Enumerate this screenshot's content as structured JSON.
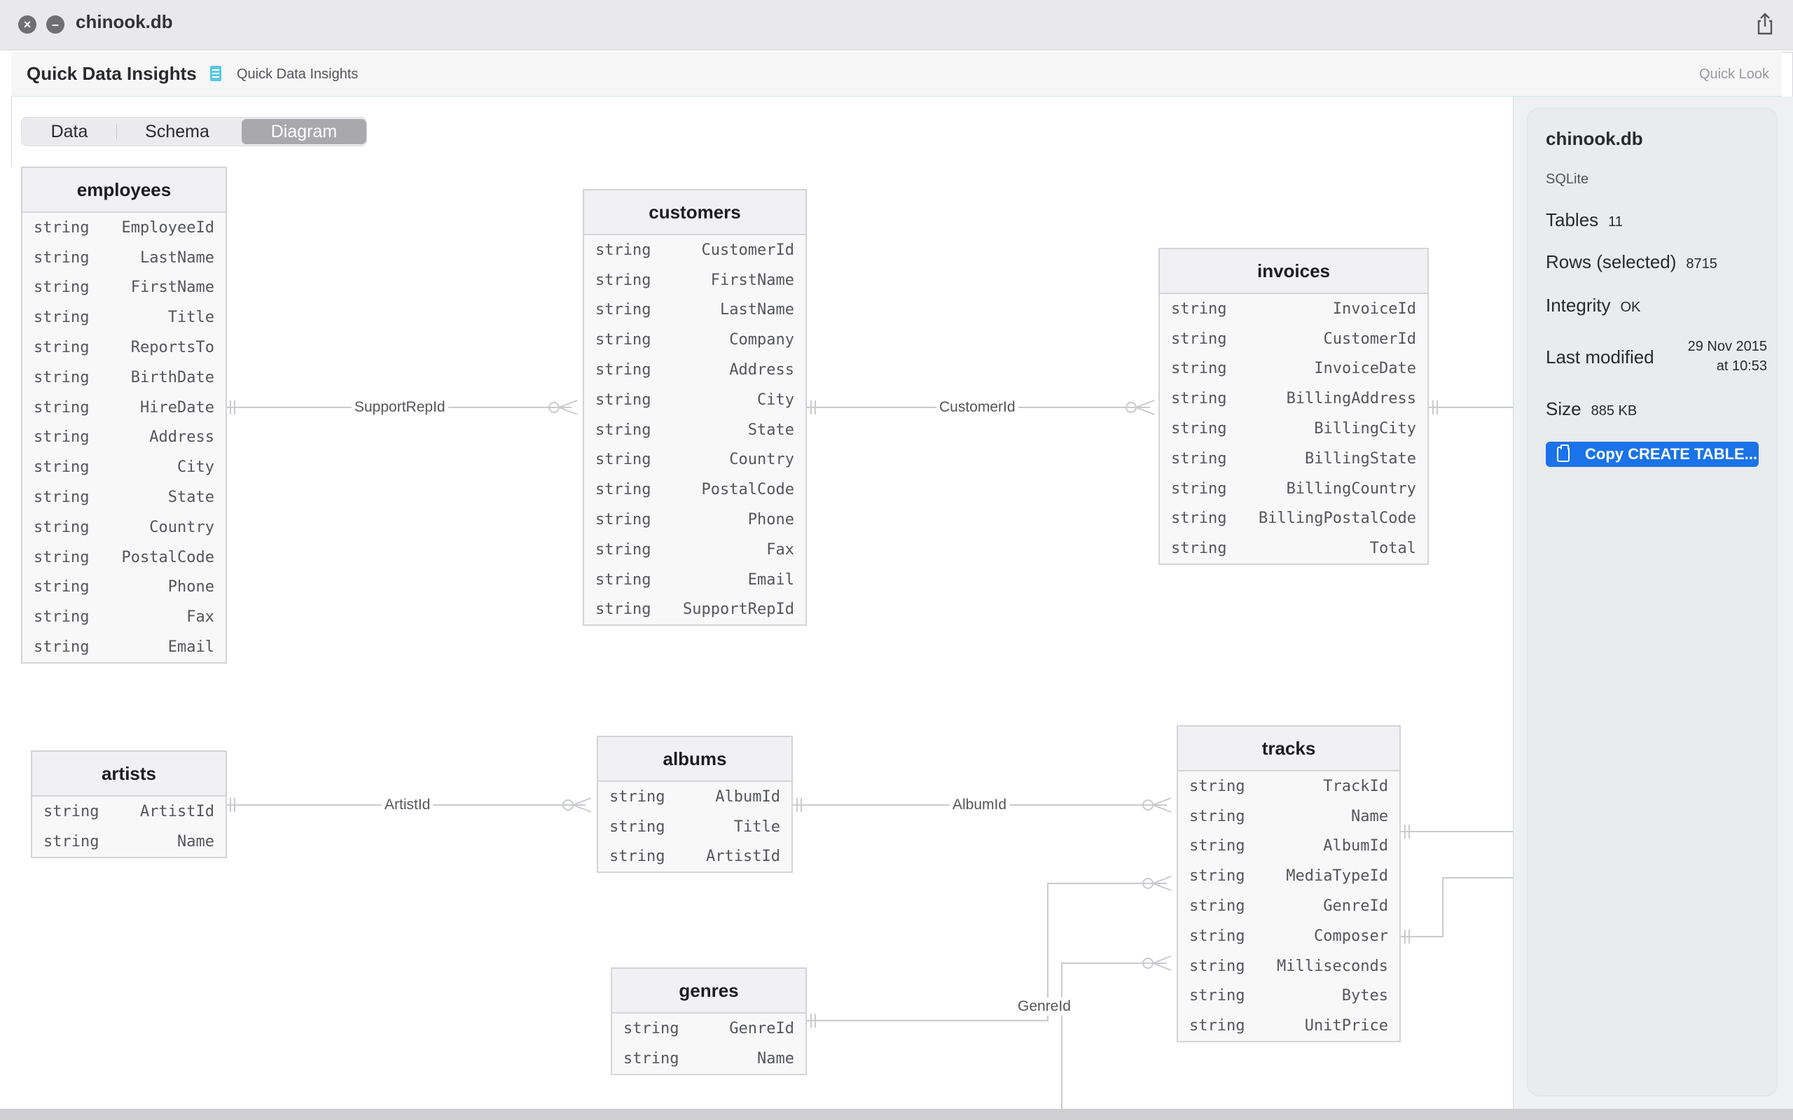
{
  "window": {
    "title": "chinook.db"
  },
  "header": {
    "title": "Quick Data Insights",
    "subtitle": "Quick Data Insights",
    "quick_look": "Quick Look"
  },
  "tabs": [
    {
      "label": "Data",
      "selected": false
    },
    {
      "label": "Schema",
      "selected": false
    },
    {
      "label": "Diagram",
      "selected": true
    }
  ],
  "diagram": {
    "tables": {
      "employees": {
        "name": "employees",
        "rows": [
          {
            "type": "string",
            "col": "EmployeeId"
          },
          {
            "type": "string",
            "col": "LastName"
          },
          {
            "type": "string",
            "col": "FirstName"
          },
          {
            "type": "string",
            "col": "Title"
          },
          {
            "type": "string",
            "col": "ReportsTo"
          },
          {
            "type": "string",
            "col": "BirthDate"
          },
          {
            "type": "string",
            "col": "HireDate"
          },
          {
            "type": "string",
            "col": "Address"
          },
          {
            "type": "string",
            "col": "City"
          },
          {
            "type": "string",
            "col": "State"
          },
          {
            "type": "string",
            "col": "Country"
          },
          {
            "type": "string",
            "col": "PostalCode"
          },
          {
            "type": "string",
            "col": "Phone"
          },
          {
            "type": "string",
            "col": "Fax"
          },
          {
            "type": "string",
            "col": "Email"
          }
        ]
      },
      "customers": {
        "name": "customers",
        "rows": [
          {
            "type": "string",
            "col": "CustomerId"
          },
          {
            "type": "string",
            "col": "FirstName"
          },
          {
            "type": "string",
            "col": "LastName"
          },
          {
            "type": "string",
            "col": "Company"
          },
          {
            "type": "string",
            "col": "Address"
          },
          {
            "type": "string",
            "col": "City"
          },
          {
            "type": "string",
            "col": "State"
          },
          {
            "type": "string",
            "col": "Country"
          },
          {
            "type": "string",
            "col": "PostalCode"
          },
          {
            "type": "string",
            "col": "Phone"
          },
          {
            "type": "string",
            "col": "Fax"
          },
          {
            "type": "string",
            "col": "Email"
          },
          {
            "type": "string",
            "col": "SupportRepId"
          }
        ]
      },
      "invoices": {
        "name": "invoices",
        "rows": [
          {
            "type": "string",
            "col": "InvoiceId"
          },
          {
            "type": "string",
            "col": "CustomerId"
          },
          {
            "type": "string",
            "col": "InvoiceDate"
          },
          {
            "type": "string",
            "col": "BillingAddress"
          },
          {
            "type": "string",
            "col": "BillingCity"
          },
          {
            "type": "string",
            "col": "BillingState"
          },
          {
            "type": "string",
            "col": "BillingCountry"
          },
          {
            "type": "string",
            "col": "BillingPostalCode"
          },
          {
            "type": "string",
            "col": "Total"
          }
        ]
      },
      "artists": {
        "name": "artists",
        "rows": [
          {
            "type": "string",
            "col": "ArtistId"
          },
          {
            "type": "string",
            "col": "Name"
          }
        ]
      },
      "albums": {
        "name": "albums",
        "rows": [
          {
            "type": "string",
            "col": "AlbumId"
          },
          {
            "type": "string",
            "col": "Title"
          },
          {
            "type": "string",
            "col": "ArtistId"
          }
        ]
      },
      "tracks": {
        "name": "tracks",
        "rows": [
          {
            "type": "string",
            "col": "TrackId"
          },
          {
            "type": "string",
            "col": "Name"
          },
          {
            "type": "string",
            "col": "AlbumId"
          },
          {
            "type": "string",
            "col": "MediaTypeId"
          },
          {
            "type": "string",
            "col": "GenreId"
          },
          {
            "type": "string",
            "col": "Composer"
          },
          {
            "type": "string",
            "col": "Milliseconds"
          },
          {
            "type": "string",
            "col": "Bytes"
          },
          {
            "type": "string",
            "col": "UnitPrice"
          }
        ]
      },
      "genres": {
        "name": "genres",
        "rows": [
          {
            "type": "string",
            "col": "GenreId"
          },
          {
            "type": "string",
            "col": "Name"
          }
        ]
      }
    },
    "relations": [
      {
        "label": "SupportRepId",
        "from": "employees",
        "to": "customers"
      },
      {
        "label": "CustomerId",
        "from": "customers",
        "to": "invoices"
      },
      {
        "label": "ArtistId",
        "from": "artists",
        "to": "albums"
      },
      {
        "label": "AlbumId",
        "from": "albums",
        "to": "tracks"
      },
      {
        "label": "GenreId",
        "from": "genres",
        "to": "tracks"
      }
    ]
  },
  "sidebar": {
    "title": "chinook.db",
    "kind": "SQLite",
    "tables_label": "Tables",
    "tables_value": "11",
    "rows_label": "Rows (selected)",
    "rows_value": "8715",
    "integrity_label": "Integrity",
    "integrity_value": "OK",
    "modified_label": "Last modified",
    "modified_date": "29 Nov 2015",
    "modified_time": "at 10:53",
    "size_label": "Size",
    "size_value": "885 KB",
    "copy_button": "Copy CREATE TABLE..."
  },
  "colors": {
    "accent": "#1a73e8",
    "segment_selected": "#a9a9ad",
    "connector": "#c9cacd"
  },
  "icons": [
    "close-icon",
    "minimize-icon",
    "share-icon",
    "document-icon",
    "copy-icon"
  ]
}
